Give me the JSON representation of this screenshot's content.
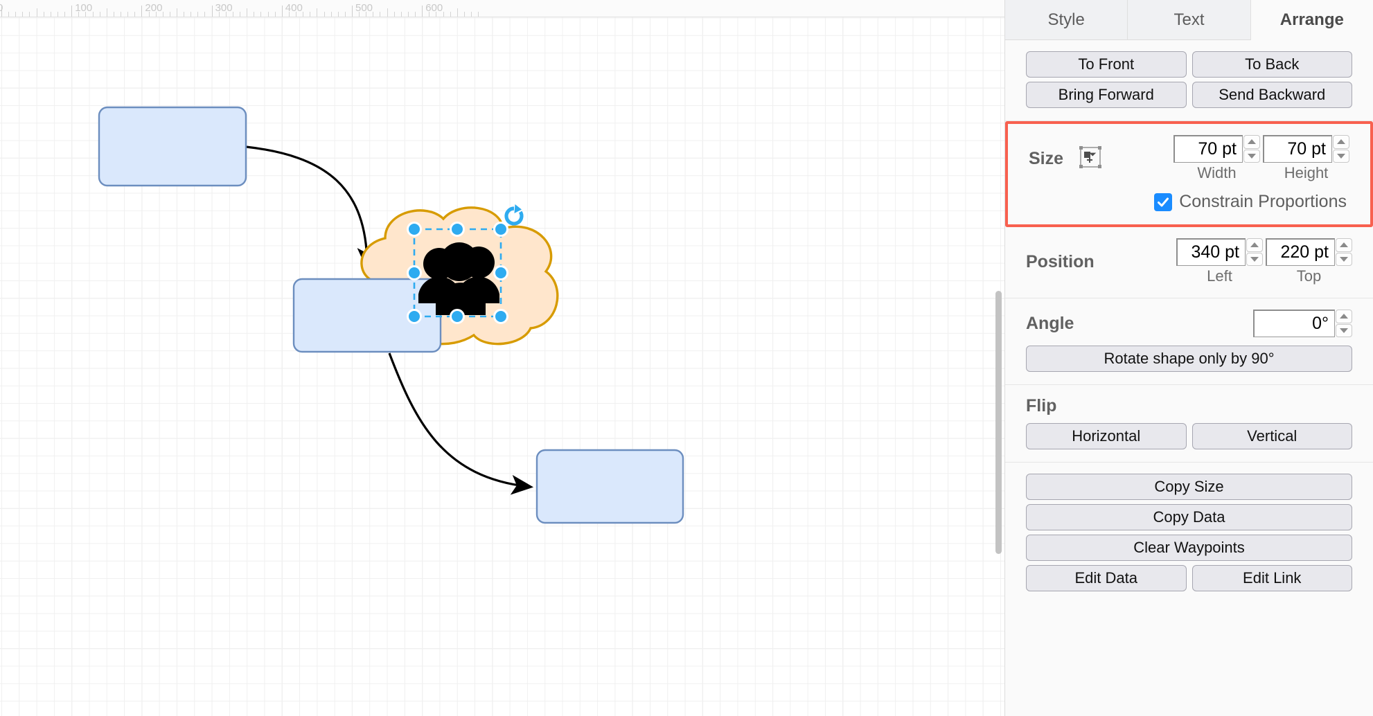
{
  "app": {
    "name": "diagram-editor"
  },
  "canvas": {
    "ruler": {
      "unit_labels": [
        "100",
        "200",
        "300",
        "400",
        "500",
        "600"
      ],
      "origin_label": "0"
    },
    "shapes": [
      {
        "id": "box-1",
        "type": "rounded-rectangle",
        "fill": "#dae8fc",
        "stroke": "#6c8ebf",
        "label": ""
      },
      {
        "id": "box-2",
        "type": "rounded-rectangle",
        "fill": "#dae8fc",
        "stroke": "#6c8ebf",
        "label": ""
      },
      {
        "id": "box-3",
        "type": "rounded-rectangle",
        "fill": "#dae8fc",
        "stroke": "#6c8ebf",
        "label": ""
      },
      {
        "id": "cloud-1",
        "type": "cloud",
        "fill": "#ffe6cc",
        "stroke": "#d79b00",
        "label": ""
      },
      {
        "id": "people-icon",
        "type": "people-group-icon",
        "fill": "#000000",
        "selected": true,
        "label": ""
      }
    ],
    "connectors": [
      {
        "id": "edge-1",
        "from": "box-1",
        "to": "box-2",
        "style": "curved-arrow",
        "color": "#000000"
      },
      {
        "id": "edge-2",
        "from": "box-2",
        "to": "box-3",
        "style": "curved-arrow",
        "color": "#000000"
      }
    ],
    "selection": {
      "handle_color": "#2eabf0",
      "rotate_icon": "rotate-icon"
    }
  },
  "panel": {
    "tabs": [
      {
        "id": "style",
        "label": "Style",
        "active": false
      },
      {
        "id": "text",
        "label": "Text",
        "active": false
      },
      {
        "id": "arrange",
        "label": "Arrange",
        "active": true
      }
    ],
    "order": {
      "to_front": "To Front",
      "to_back": "To Back",
      "bring_forward": "Bring Forward",
      "send_backward": "Send Backward"
    },
    "size": {
      "title": "Size",
      "icon": "autosize-icon",
      "width_value": "70 pt",
      "height_value": "70 pt",
      "width_caption": "Width",
      "height_caption": "Height",
      "constrain_label": "Constrain Proportions",
      "constrain_checked": true,
      "highlight_color": "#f8604f"
    },
    "position": {
      "title": "Position",
      "left_value": "340 pt",
      "top_value": "220 pt",
      "left_caption": "Left",
      "top_caption": "Top"
    },
    "angle": {
      "title": "Angle",
      "value": "0°",
      "rotate_button": "Rotate shape only by 90°"
    },
    "flip": {
      "title": "Flip",
      "horizontal": "Horizontal",
      "vertical": "Vertical"
    },
    "actions": {
      "copy_size": "Copy Size",
      "copy_data": "Copy Data",
      "clear_waypoints": "Clear Waypoints",
      "edit_data": "Edit Data",
      "edit_link": "Edit Link"
    }
  }
}
